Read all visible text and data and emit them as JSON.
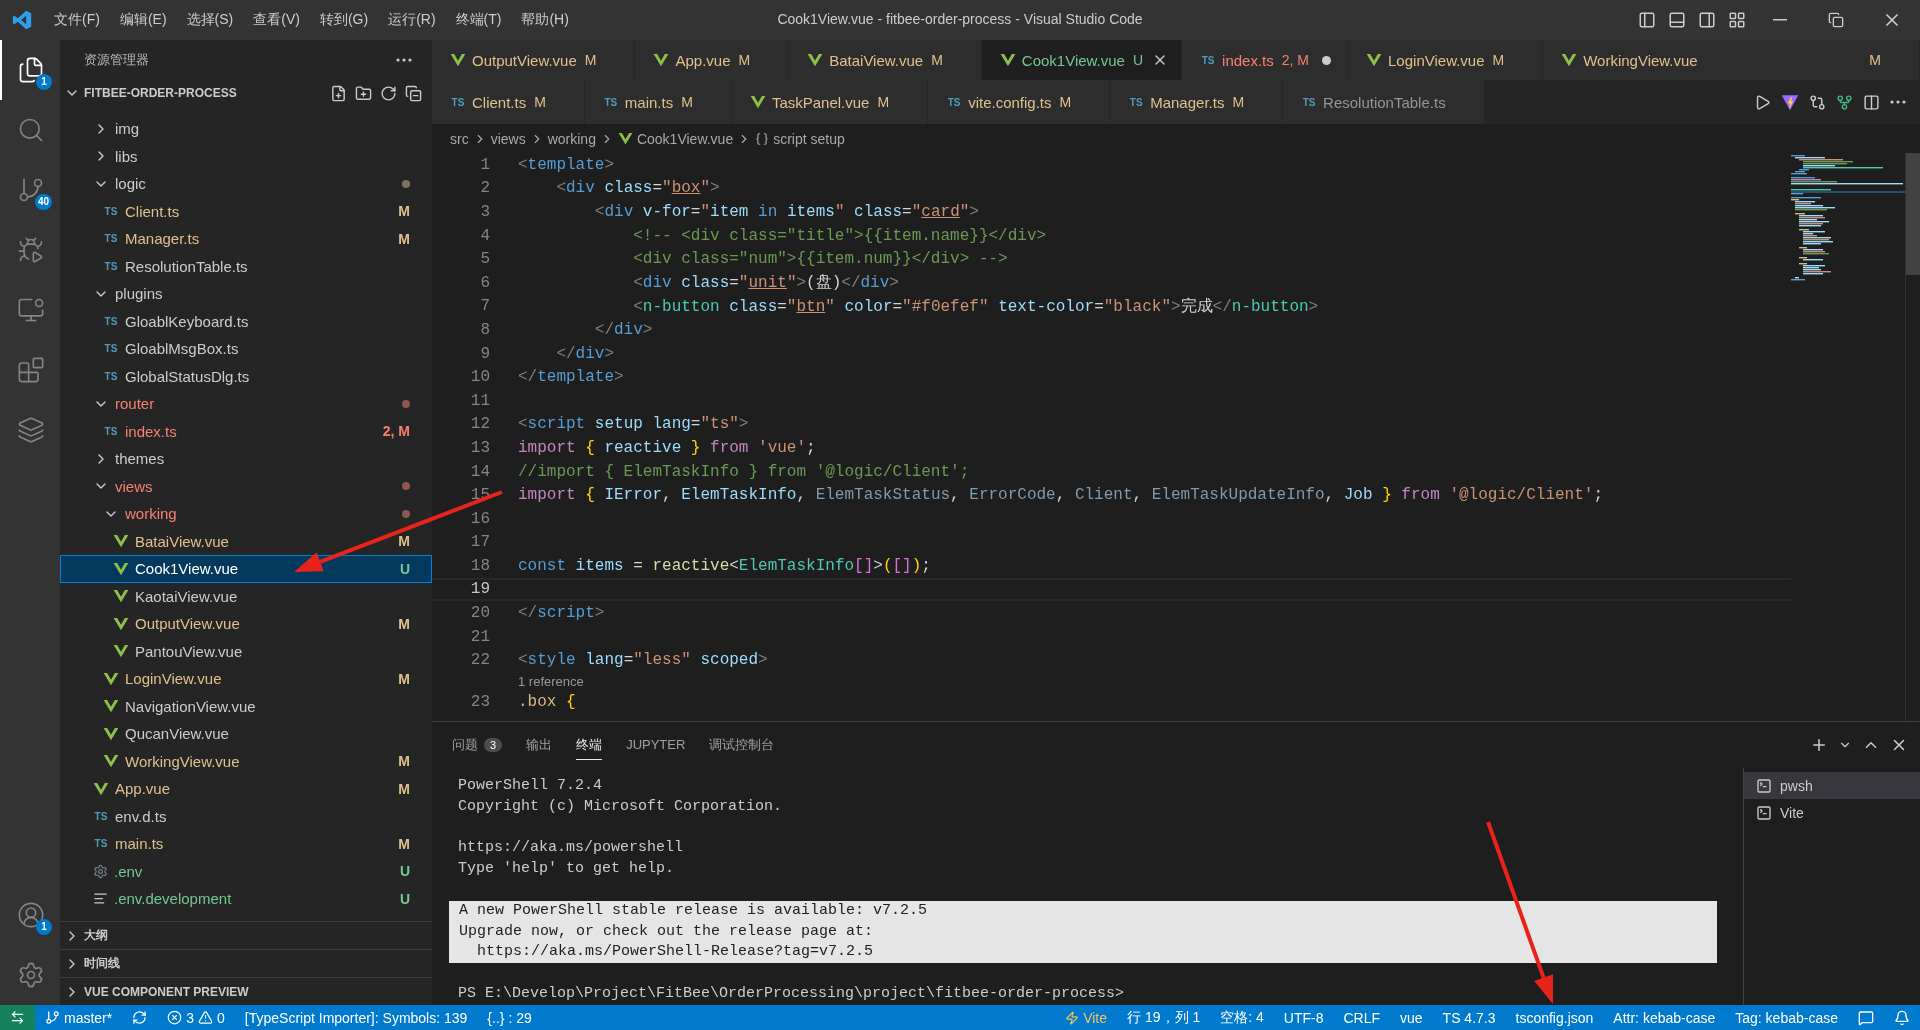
{
  "title_bar": {
    "menus": [
      "文件(F)",
      "编辑(E)",
      "选择(S)",
      "查看(V)",
      "转到(G)",
      "运行(R)",
      "终端(T)",
      "帮助(H)"
    ],
    "title": "Cook1View.vue - fitbee-order-process - Visual Studio Code"
  },
  "activity_bar": {
    "top": [
      {
        "kind": "explorer",
        "selected": true,
        "badge": "1"
      },
      {
        "kind": "search",
        "selected": false
      },
      {
        "kind": "source_control",
        "selected": false,
        "badge": "40"
      },
      {
        "kind": "run",
        "selected": false
      },
      {
        "kind": "remote",
        "selected": false
      },
      {
        "kind": "extensions",
        "selected": false
      },
      {
        "kind": "layers",
        "selected": false
      }
    ],
    "bottom": [
      {
        "kind": "account",
        "selected": false,
        "badge": "1"
      },
      {
        "kind": "settings",
        "selected": false
      }
    ]
  },
  "sidebar": {
    "title": "资源管理器",
    "project": {
      "name": "FITBEE-ORDER-PROCESS",
      "expanded": true,
      "tree": [
        {
          "kind": "folder",
          "name": "img",
          "expanded": false,
          "selected": false
        },
        {
          "kind": "folder",
          "name": "libs",
          "expanded": false,
          "selected": false
        },
        {
          "kind": "folder",
          "name": "logic",
          "expanded": true,
          "selected": false,
          "dot": {
            "color": "#7d705e"
          },
          "children": [
            {
              "kind": "ts",
              "icon_label": "TS",
              "name": "Client.ts",
              "selected": false,
              "color": "#e2c08d",
              "badge": "M"
            },
            {
              "kind": "ts",
              "icon_label": "TS",
              "name": "Manager.ts",
              "selected": false,
              "color": "#e2c08d",
              "badge": "M"
            },
            {
              "kind": "ts",
              "icon_label": "TS",
              "name": "ResolutionTable.ts",
              "selected": false
            }
          ]
        },
        {
          "kind": "folder",
          "name": "plugins",
          "expanded": true,
          "selected": false,
          "children": [
            {
              "kind": "ts",
              "icon_label": "TS",
              "name": "GloablKeyboard.ts",
              "selected": false
            },
            {
              "kind": "ts",
              "icon_label": "TS",
              "name": "GloablMsgBox.ts",
              "selected": false
            },
            {
              "kind": "ts",
              "icon_label": "TS",
              "name": "GlobalStatusDlg.ts",
              "selected": false
            }
          ]
        },
        {
          "kind": "folder",
          "name": "router",
          "expanded": true,
          "selected": false,
          "color": "#f88070",
          "dot": {
            "color": "#8e5650"
          },
          "children": [
            {
              "kind": "ts",
              "icon_label": "TS",
              "name": "index.ts",
              "selected": false,
              "color": "#f88070",
              "badge": "2, M"
            }
          ]
        },
        {
          "kind": "folder",
          "name": "themes",
          "expanded": false,
          "selected": false
        },
        {
          "kind": "folder",
          "name": "views",
          "expanded": true,
          "selected": false,
          "color": "#f88070",
          "dot": {
            "color": "#8e5650"
          },
          "children": [
            {
              "kind": "folder",
              "name": "working",
              "expanded": true,
              "selected": false,
              "color": "#f88070",
              "dot": {
                "color": "#8e5650"
              },
              "children": [
                {
                  "kind": "vue",
                  "name": "BataiView.vue",
                  "selected": false,
                  "color": "#e2c08d",
                  "badge": "M"
                },
                {
                  "kind": "vue",
                  "name": "Cook1View.vue",
                  "selected": true,
                  "color": "#73c991",
                  "badge": "U"
                },
                {
                  "kind": "vue",
                  "name": "KaotaiView.vue",
                  "selected": false
                },
                {
                  "kind": "vue",
                  "name": "OutputView.vue",
                  "selected": false,
                  "color": "#e2c08d",
                  "badge": "M"
                },
                {
                  "kind": "vue",
                  "name": "PantouView.vue",
                  "selected": false
                }
              ]
            },
            {
              "kind": "vue",
              "name": "LoginView.vue",
              "selected": false,
              "color": "#e2c08d",
              "badge": "M"
            },
            {
              "kind": "vue",
              "name": "NavigationView.vue",
              "selected": false
            },
            {
              "kind": "vue",
              "name": "QucanView.vue",
              "selected": false
            },
            {
              "kind": "vue",
              "name": "WorkingView.vue",
              "selected": false,
              "color": "#e2c08d",
              "badge": "M"
            }
          ]
        },
        {
          "kind": "vue",
          "name": "App.vue",
          "selected": false,
          "color": "#e2c08d",
          "badge": "M"
        },
        {
          "kind": "ts",
          "icon_label": "TS",
          "name": "env.d.ts",
          "selected": false
        },
        {
          "kind": "ts",
          "icon_label": "TS",
          "name": "main.ts",
          "selected": false,
          "color": "#e2c08d",
          "badge": "M"
        },
        {
          "kind": "gear",
          "name": ".env",
          "selected": false,
          "color": "#73c991",
          "badge": "U"
        },
        {
          "kind": "lines",
          "name": ".env.development",
          "selected": false,
          "color": "#73c991",
          "badge": "U"
        }
      ]
    },
    "sections": [
      {
        "name": "大纲",
        "expanded": false
      },
      {
        "name": "时间线",
        "expanded": false
      },
      {
        "name": "VUE COMPONENT PREVIEW",
        "expanded": false
      }
    ]
  },
  "editor": {
    "tab_rows": [
      [
        {
          "name": "OutputView.vue",
          "kind": "vue",
          "badge": "M",
          "color": "#e2c08d",
          "selected": false,
          "dirty": false
        },
        {
          "name": "App.vue",
          "kind": "vue",
          "badge": "M",
          "color": "#e2c08d",
          "selected": false,
          "dirty": false
        },
        {
          "name": "BataiView.vue",
          "kind": "vue",
          "badge": "M",
          "color": "#e2c08d",
          "selected": false,
          "dirty": false
        },
        {
          "name": "Cook1View.vue",
          "kind": "vue",
          "badge": "U",
          "color": "#73c991",
          "selected": true,
          "dirty": false
        },
        {
          "name": "index.ts",
          "kind": "ts",
          "icon_label": "TS",
          "badge": "2, M",
          "color": "#f88070",
          "selected": false,
          "dirty": true
        },
        {
          "name": "LoginView.vue",
          "kind": "vue",
          "badge": "M",
          "color": "#e2c08d",
          "selected": false,
          "dirty": false
        },
        {
          "name": "WorkingView.vue",
          "kind": "vue",
          "badge": "M",
          "color": "#e2c08d",
          "selected": false,
          "dirty": false
        }
      ],
      [
        {
          "name": "Client.ts",
          "kind": "ts",
          "icon_label": "TS",
          "badge": "M",
          "color": "#e2c08d",
          "selected": false,
          "dirty": false
        },
        {
          "name": "main.ts",
          "kind": "ts",
          "icon_label": "TS",
          "badge": "M",
          "color": "#e2c08d",
          "selected": false,
          "dirty": false
        },
        {
          "name": "TaskPanel.vue",
          "kind": "vue",
          "badge": "M",
          "color": "#e2c08d",
          "selected": false,
          "dirty": false
        },
        {
          "name": "vite.config.ts",
          "kind": "ts",
          "icon_label": "TS",
          "badge": "M",
          "color": "#e2c08d",
          "selected": false,
          "dirty": false
        },
        {
          "name": "Manager.ts",
          "kind": "ts",
          "icon_label": "TS",
          "badge": "M",
          "color": "#e2c08d",
          "selected": false,
          "dirty": false
        },
        {
          "name": "ResolutionTable.ts",
          "kind": "ts",
          "icon_label": "TS",
          "selected": false,
          "dirty": false
        }
      ]
    ],
    "breadcrumb": [
      {
        "kind": "folder",
        "text": "src"
      },
      {
        "kind": "folder",
        "text": "views"
      },
      {
        "kind": "folder",
        "text": "working"
      },
      {
        "kind": "vue",
        "text": "Cook1View.vue"
      },
      {
        "kind": "symbol",
        "text": "script setup"
      }
    ],
    "lines": [
      {
        "kind": "code",
        "number": "1",
        "current": false,
        "tokens": [
          {
            "kind": "punct",
            "text": "<"
          },
          {
            "kind": "tag",
            "text": "template"
          },
          {
            "kind": "punct",
            "text": ">"
          }
        ]
      },
      {
        "kind": "code",
        "number": "2",
        "current": false,
        "tokens": [
          {
            "kind": "punct",
            "text": "    <"
          },
          {
            "kind": "tag",
            "text": "div"
          },
          {
            "kind": "attr",
            "text": " class"
          },
          {
            "kind": "text",
            "text": "="
          },
          {
            "kind": "string",
            "text": "\""
          },
          {
            "kind": "stringu",
            "text": "box"
          },
          {
            "kind": "string",
            "text": "\""
          },
          {
            "kind": "punct",
            "text": ">"
          }
        ]
      },
      {
        "kind": "code",
        "number": "3",
        "current": false,
        "tokens": [
          {
            "kind": "punct",
            "text": "        <"
          },
          {
            "kind": "tag",
            "text": "div"
          },
          {
            "kind": "attr",
            "text": " v-for"
          },
          {
            "kind": "text",
            "text": "="
          },
          {
            "kind": "string",
            "text": "\""
          },
          {
            "kind": "var",
            "text": "item"
          },
          {
            "kind": "tag",
            "text": " in "
          },
          {
            "kind": "var",
            "text": "items"
          },
          {
            "kind": "string",
            "text": "\""
          },
          {
            "kind": "attr",
            "text": " class"
          },
          {
            "kind": "text",
            "text": "="
          },
          {
            "kind": "string",
            "text": "\""
          },
          {
            "kind": "stringu",
            "text": "card"
          },
          {
            "kind": "string",
            "text": "\""
          },
          {
            "kind": "punct",
            "text": ">"
          }
        ]
      },
      {
        "kind": "code",
        "number": "4",
        "current": false,
        "tokens": [
          {
            "kind": "comment",
            "text": "            <!-- <div class=\"title\">{{item.name}}</div>"
          }
        ]
      },
      {
        "kind": "code",
        "number": "5",
        "current": false,
        "tokens": [
          {
            "kind": "comment",
            "text": "            <div class=\"num\">{{item.num}}</div> -->"
          }
        ]
      },
      {
        "kind": "code",
        "number": "6",
        "current": false,
        "tokens": [
          {
            "kind": "punct",
            "text": "            <"
          },
          {
            "kind": "tag",
            "text": "div"
          },
          {
            "kind": "attr",
            "text": " class"
          },
          {
            "kind": "text",
            "text": "="
          },
          {
            "kind": "string",
            "text": "\""
          },
          {
            "kind": "stringu",
            "text": "unit"
          },
          {
            "kind": "string",
            "text": "\""
          },
          {
            "kind": "punct",
            "text": ">"
          },
          {
            "kind": "text",
            "text": "(盘)"
          },
          {
            "kind": "punct",
            "text": "</"
          },
          {
            "kind": "tag",
            "text": "div"
          },
          {
            "kind": "punct",
            "text": ">"
          }
        ]
      },
      {
        "kind": "code",
        "number": "7",
        "current": false,
        "tokens": [
          {
            "kind": "punct",
            "text": "            <"
          },
          {
            "kind": "type",
            "text": "n-button"
          },
          {
            "kind": "attr",
            "text": " class"
          },
          {
            "kind": "text",
            "text": "="
          },
          {
            "kind": "string",
            "text": "\""
          },
          {
            "kind": "stringu",
            "text": "btn"
          },
          {
            "kind": "string",
            "text": "\""
          },
          {
            "kind": "attr",
            "text": " color"
          },
          {
            "kind": "text",
            "text": "="
          },
          {
            "kind": "string",
            "text": "\"#f0efef\""
          },
          {
            "kind": "attr",
            "text": " text-color"
          },
          {
            "kind": "text",
            "text": "="
          },
          {
            "kind": "string",
            "text": "\"black\""
          },
          {
            "kind": "punct",
            "text": ">"
          },
          {
            "kind": "text",
            "text": "完成"
          },
          {
            "kind": "punct",
            "text": "</"
          },
          {
            "kind": "type",
            "text": "n-button"
          },
          {
            "kind": "punct",
            "text": ">"
          }
        ]
      },
      {
        "kind": "code",
        "number": "8",
        "current": false,
        "tokens": [
          {
            "kind": "punct",
            "text": "        </"
          },
          {
            "kind": "tag",
            "text": "div"
          },
          {
            "kind": "punct",
            "text": ">"
          }
        ]
      },
      {
        "kind": "code",
        "number": "9",
        "current": false,
        "tokens": [
          {
            "kind": "punct",
            "text": "    </"
          },
          {
            "kind": "tag",
            "text": "div"
          },
          {
            "kind": "punct",
            "text": ">"
          }
        ]
      },
      {
        "kind": "code",
        "number": "10",
        "current": false,
        "tokens": [
          {
            "kind": "punct",
            "text": "</"
          },
          {
            "kind": "tag",
            "text": "template"
          },
          {
            "kind": "punct",
            "text": ">"
          }
        ]
      },
      {
        "kind": "code",
        "number": "11",
        "current": false
      },
      {
        "kind": "code",
        "number": "12",
        "current": false,
        "tokens": [
          {
            "kind": "punct",
            "text": "<"
          },
          {
            "kind": "tag",
            "text": "script"
          },
          {
            "kind": "attr",
            "text": " setup"
          },
          {
            "kind": "attr",
            "text": " lang"
          },
          {
            "kind": "text",
            "text": "="
          },
          {
            "kind": "string",
            "text": "\"ts\""
          },
          {
            "kind": "punct",
            "text": ">"
          }
        ]
      },
      {
        "kind": "code",
        "number": "13",
        "current": false,
        "tokens": [
          {
            "kind": "keyword",
            "text": "import"
          },
          {
            "kind": "bracket",
            "text": " {"
          },
          {
            "kind": "var",
            "text": " reactive "
          },
          {
            "kind": "bracket",
            "text": "}"
          },
          {
            "kind": "keyword",
            "text": " from"
          },
          {
            "kind": "string",
            "text": " 'vue'"
          },
          {
            "kind": "text",
            "text": ";"
          }
        ]
      },
      {
        "kind": "code",
        "number": "14",
        "current": false,
        "tokens": [
          {
            "kind": "comment",
            "text": "//import { ElemTaskInfo } from '@logic/Client';"
          }
        ]
      },
      {
        "kind": "code",
        "number": "15",
        "current": false,
        "tokens": [
          {
            "kind": "keyword",
            "text": "import"
          },
          {
            "kind": "bracket",
            "text": " {"
          },
          {
            "kind": "var",
            "text": " IError"
          },
          {
            "kind": "text",
            "text": ", "
          },
          {
            "kind": "var",
            "text": "ElemTaskInfo"
          },
          {
            "kind": "text",
            "text": ", "
          },
          {
            "kind": "unused",
            "text": "ElemTaskStatus"
          },
          {
            "kind": "text",
            "text": ", "
          },
          {
            "kind": "unused",
            "text": "ErrorCode"
          },
          {
            "kind": "text",
            "text": ", "
          },
          {
            "kind": "unused",
            "text": "Client"
          },
          {
            "kind": "text",
            "text": ", "
          },
          {
            "kind": "unused",
            "text": "ElemTaskUpdateInfo"
          },
          {
            "kind": "text",
            "text": ", "
          },
          {
            "kind": "var",
            "text": "Job "
          },
          {
            "kind": "bracket",
            "text": "}"
          },
          {
            "kind": "keyword",
            "text": " from"
          },
          {
            "kind": "string",
            "text": " '@logic/Client'"
          },
          {
            "kind": "text",
            "text": ";"
          }
        ]
      },
      {
        "kind": "code",
        "number": "16",
        "current": false
      },
      {
        "kind": "code",
        "number": "17",
        "current": false
      },
      {
        "kind": "code",
        "number": "18",
        "current": false,
        "tokens": [
          {
            "kind": "storage",
            "text": "const"
          },
          {
            "kind": "var",
            "text": " items"
          },
          {
            "kind": "text",
            "text": " = "
          },
          {
            "kind": "func",
            "text": "reactive"
          },
          {
            "kind": "text",
            "text": "<"
          },
          {
            "kind": "type",
            "text": "ElemTaskInfo"
          },
          {
            "kind": "bracket2",
            "text": "[]"
          },
          {
            "kind": "text",
            "text": ">"
          },
          {
            "kind": "bracket",
            "text": "("
          },
          {
            "kind": "bracket2",
            "text": "[]"
          },
          {
            "kind": "bracket",
            "text": ")"
          },
          {
            "kind": "text",
            "text": ";"
          }
        ]
      },
      {
        "kind": "code",
        "number": "19",
        "current": true
      },
      {
        "kind": "code",
        "number": "20",
        "current": false,
        "tokens": [
          {
            "kind": "punct",
            "text": "</"
          },
          {
            "kind": "tag",
            "text": "script"
          },
          {
            "kind": "punct",
            "text": ">"
          }
        ]
      },
      {
        "kind": "code",
        "number": "21",
        "current": false
      },
      {
        "kind": "code",
        "number": "22",
        "current": false,
        "tokens": [
          {
            "kind": "punct",
            "text": "<"
          },
          {
            "kind": "tag",
            "text": "style"
          },
          {
            "kind": "attr",
            "text": " lang"
          },
          {
            "kind": "text",
            "text": "="
          },
          {
            "kind": "string",
            "text": "\"less\""
          },
          {
            "kind": "attr",
            "text": " scoped"
          },
          {
            "kind": "punct",
            "text": ">"
          }
        ]
      },
      {
        "kind": "lens",
        "text": "1 reference"
      },
      {
        "kind": "code",
        "number": "23",
        "current": false,
        "tokens": [
          {
            "kind": "selector",
            "text": ".box"
          },
          {
            "kind": "bracket",
            "text": " {"
          }
        ]
      }
    ]
  },
  "panel": {
    "tabs": [
      {
        "label": "问题",
        "badge": "3",
        "selected": false
      },
      {
        "label": "输出",
        "selected": false
      },
      {
        "label": "终端",
        "selected": true
      },
      {
        "label": "JUPYTER",
        "selected": false
      },
      {
        "label": "调试控制台",
        "selected": false
      }
    ],
    "terminal": {
      "blocks": [
        {
          "kind": "text",
          "lines": [
            "PowerShell 7.2.4",
            "Copyright (c) Microsoft Corporation."
          ]
        },
        {
          "kind": "text",
          "lines": [
            "https://aka.ms/powershell",
            "Type 'help' to get help."
          ]
        },
        {
          "kind": "notice",
          "lines": [
            "A new PowerShell stable release is available: v7.2.5",
            "Upgrade now, or check out the release page at:",
            "  https://aka.ms/PowerShell-Release?tag=v7.2.5"
          ]
        },
        {
          "kind": "text",
          "lines": [
            "PS E:\\Develop\\Project\\FitBee\\OrderProcessing\\project\\fitbee-order-process>"
          ]
        }
      ]
    },
    "terminals": [
      {
        "name": "pwsh",
        "selected": true
      },
      {
        "name": "Vite",
        "selected": false
      }
    ]
  },
  "status_bar": {
    "left": [
      {
        "kind": "remote"
      },
      {
        "kind": "branch",
        "text": "master*"
      },
      {
        "kind": "sync"
      },
      {
        "kind": "problems",
        "errors": "3",
        "warnings": "0"
      },
      {
        "kind": "plain",
        "text": "[TypeScript Importer]: Symbols: 139"
      },
      {
        "kind": "plain",
        "text": "{..} : 29"
      }
    ],
    "right": [
      {
        "kind": "vite",
        "text": "Vite"
      },
      {
        "kind": "plain",
        "text": "行 19，列 1"
      },
      {
        "kind": "plain",
        "text": "空格: 4"
      },
      {
        "kind": "plain",
        "text": "UTF-8"
      },
      {
        "kind": "plain",
        "text": "CRLF"
      },
      {
        "kind": "plain",
        "text": "vue"
      },
      {
        "kind": "plain",
        "text": "TS 4.7.3"
      },
      {
        "kind": "plain",
        "text": "tsconfig.json"
      },
      {
        "kind": "plain",
        "text": "Attr: kebab-case"
      },
      {
        "kind": "plain",
        "text": "Tag: kebab-case"
      },
      {
        "kind": "feedback"
      },
      {
        "kind": "bell"
      }
    ]
  }
}
